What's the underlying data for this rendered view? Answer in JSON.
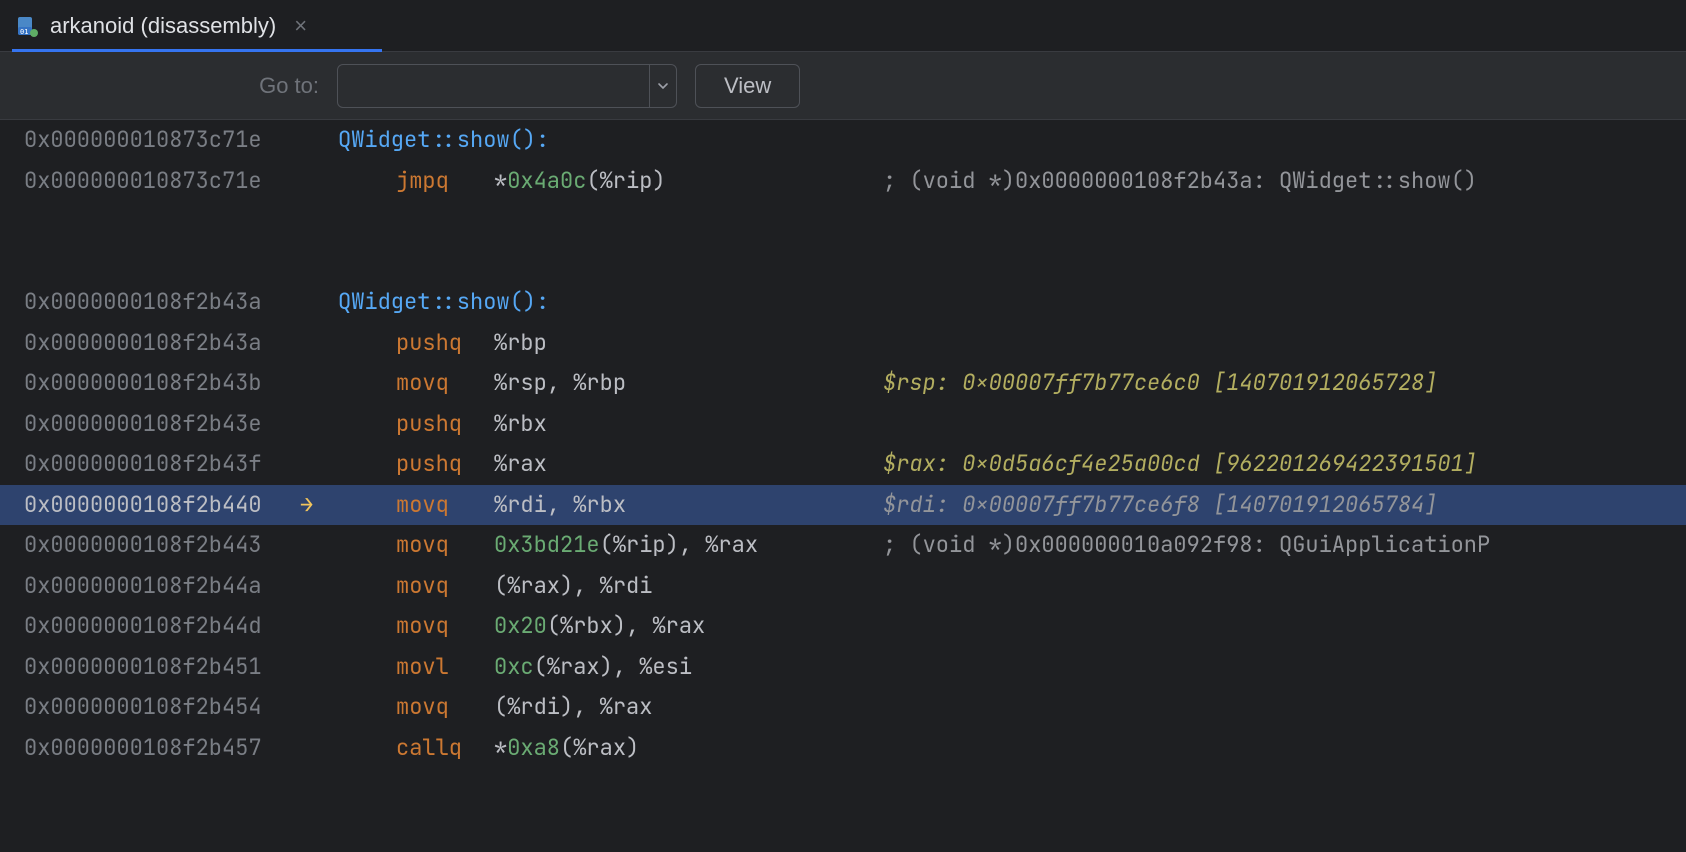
{
  "tab": {
    "title": "arkanoid (disassembly)",
    "close": "×"
  },
  "toolbar": {
    "goto_label": "Go to:",
    "goto_value": "",
    "view_label": "View"
  },
  "rows": [
    {
      "addr": "0x000000010873c71e",
      "arrow": "",
      "kind": "func",
      "func": "QWidget::show():"
    },
    {
      "addr": "0x000000010873c71e",
      "arrow": "",
      "kind": "instr",
      "op": "jmpq",
      "args": [
        {
          "t": "star",
          "v": "*"
        },
        {
          "t": "num",
          "v": "0x4a0c"
        },
        {
          "t": "reg",
          "v": "("
        },
        {
          "t": "reg",
          "v": "%rip"
        },
        {
          "t": "reg",
          "v": ")"
        }
      ],
      "comment_plain": "; (void *)0x0000000108f2b43a: QWidget::show()"
    },
    {
      "addr": "",
      "arrow": "",
      "kind": "blank"
    },
    {
      "addr": "",
      "arrow": "",
      "kind": "blank"
    },
    {
      "addr": "0x0000000108f2b43a",
      "arrow": "",
      "kind": "func",
      "func": "QWidget::show():"
    },
    {
      "addr": "0x0000000108f2b43a",
      "arrow": "",
      "kind": "instr",
      "op": "pushq",
      "args": [
        {
          "t": "reg",
          "v": "%rbp"
        }
      ]
    },
    {
      "addr": "0x0000000108f2b43b",
      "arrow": "",
      "kind": "instr",
      "op": "movq",
      "args": [
        {
          "t": "reg",
          "v": "%rsp"
        },
        {
          "t": "reg",
          "v": ", "
        },
        {
          "t": "reg",
          "v": "%rbp"
        }
      ],
      "comment_kv": {
        "k": "$rsp:",
        "v": " 0x00007ff7b77ce6c0 [140701912065728]"
      }
    },
    {
      "addr": "0x0000000108f2b43e",
      "arrow": "",
      "kind": "instr",
      "op": "pushq",
      "args": [
        {
          "t": "reg",
          "v": "%rbx"
        }
      ]
    },
    {
      "addr": "0x0000000108f2b43f",
      "arrow": "",
      "kind": "instr",
      "op": "pushq",
      "args": [
        {
          "t": "reg",
          "v": "%rax"
        }
      ],
      "comment_kv": {
        "k": "$rax:",
        "v": " 0x0d5a6cf4e25a00cd [962201269422391501]"
      }
    },
    {
      "addr": "0x0000000108f2b440",
      "arrow": "→",
      "highlight": true,
      "kind": "instr",
      "op": "movq",
      "args": [
        {
          "t": "reg",
          "v": "%rdi"
        },
        {
          "t": "reg",
          "v": ", "
        },
        {
          "t": "reg",
          "v": "%rbx"
        }
      ],
      "comment_kv": {
        "k": "$rdi:",
        "v": " 0x00007ff7b77ce6f8 [140701912065784]"
      }
    },
    {
      "addr": "0x0000000108f2b443",
      "arrow": "",
      "kind": "instr",
      "op": "movq",
      "args": [
        {
          "t": "num",
          "v": "0x3bd21e"
        },
        {
          "t": "reg",
          "v": "("
        },
        {
          "t": "reg",
          "v": "%rip"
        },
        {
          "t": "reg",
          "v": ")"
        },
        {
          "t": "reg",
          "v": ", "
        },
        {
          "t": "reg",
          "v": "%rax"
        }
      ],
      "comment_plain": "; (void *)0x000000010a092f98: QGuiApplicationP"
    },
    {
      "addr": "0x0000000108f2b44a",
      "arrow": "",
      "kind": "instr",
      "op": "movq",
      "args": [
        {
          "t": "reg",
          "v": "("
        },
        {
          "t": "reg",
          "v": "%rax"
        },
        {
          "t": "reg",
          "v": ")"
        },
        {
          "t": "reg",
          "v": ", "
        },
        {
          "t": "reg",
          "v": "%rdi"
        }
      ]
    },
    {
      "addr": "0x0000000108f2b44d",
      "arrow": "",
      "kind": "instr",
      "op": "movq",
      "args": [
        {
          "t": "num",
          "v": "0x20"
        },
        {
          "t": "reg",
          "v": "("
        },
        {
          "t": "reg",
          "v": "%rbx"
        },
        {
          "t": "reg",
          "v": ")"
        },
        {
          "t": "reg",
          "v": ", "
        },
        {
          "t": "reg",
          "v": "%rax"
        }
      ]
    },
    {
      "addr": "0x0000000108f2b451",
      "arrow": "",
      "kind": "instr",
      "op": "movl",
      "args": [
        {
          "t": "num",
          "v": "0xc"
        },
        {
          "t": "reg",
          "v": "("
        },
        {
          "t": "reg",
          "v": "%rax"
        },
        {
          "t": "reg",
          "v": ")"
        },
        {
          "t": "reg",
          "v": ", "
        },
        {
          "t": "reg",
          "v": "%esi"
        }
      ]
    },
    {
      "addr": "0x0000000108f2b454",
      "arrow": "",
      "kind": "instr",
      "op": "movq",
      "args": [
        {
          "t": "reg",
          "v": "("
        },
        {
          "t": "reg",
          "v": "%rdi"
        },
        {
          "t": "reg",
          "v": ")"
        },
        {
          "t": "reg",
          "v": ", "
        },
        {
          "t": "reg",
          "v": "%rax"
        }
      ]
    },
    {
      "addr": "0x0000000108f2b457",
      "arrow": "",
      "kind": "instr",
      "op": "callq",
      "args": [
        {
          "t": "star",
          "v": "*"
        },
        {
          "t": "num",
          "v": "0xa8"
        },
        {
          "t": "reg",
          "v": "("
        },
        {
          "t": "reg",
          "v": "%rax"
        },
        {
          "t": "reg",
          "v": ")"
        }
      ]
    }
  ]
}
